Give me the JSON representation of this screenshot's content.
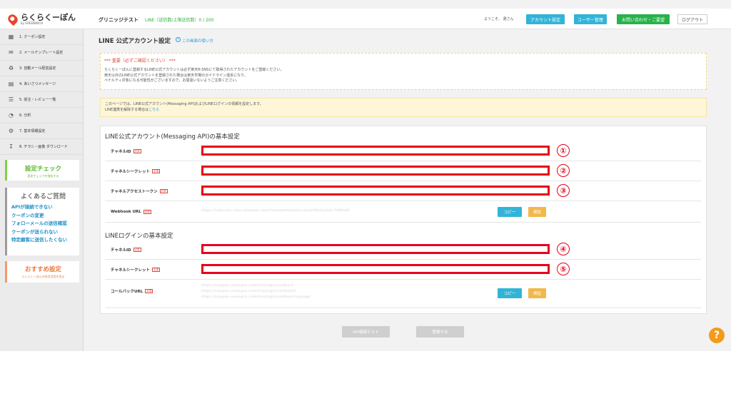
{
  "header": {
    "logo_main": "らくらくーぽん",
    "logo_sub": "by GREENWICH",
    "shop_name": "グリニッジテスト",
    "line_count": "LINE（送信数/上限送信数）0 / 200",
    "welcome": "ようこそ、 書さん",
    "account_settings": "アカウント設定",
    "user_management": "ユーザー管理",
    "contact": "お問い合わせ・ご要望",
    "logout": "ログアウト"
  },
  "sidebar": {
    "items": [
      {
        "label": "1. クーポン設定",
        "icon": "coupon-icon"
      },
      {
        "label": "2. メールテンプレート設定",
        "icon": "mail-icon"
      },
      {
        "label": "3. 自動メール配信設定",
        "icon": "auto-mail-icon"
      },
      {
        "label": "4. あいさつメッセージ",
        "icon": "message-icon"
      },
      {
        "label": "5. 受注・レビュー一覧",
        "icon": "list-icon"
      },
      {
        "label": "6. 分析",
        "icon": "pie-chart-icon"
      },
      {
        "label": "7. 基本情報設定",
        "icon": "gear-icon"
      },
      {
        "label": "8. チラシ・画像 ダウンロード",
        "icon": "download-icon"
      }
    ],
    "settings_check": {
      "title": "設定チェック",
      "subtitle": "設定チェックを強化する"
    },
    "faq": {
      "title": "よくあるご質問",
      "links": [
        "APIが接続できない",
        "クーポンの変更",
        "フォローメールの送信確認",
        "クーポンが送られない",
        "特定顧客に送信したくない"
      ]
    },
    "recommended": {
      "title": "おすすめ設定",
      "subtitle": "らくらくーぽんの有効活用を見る"
    }
  },
  "main": {
    "title": "LINE 公式アカウント設定",
    "help_link": "この画面の使い方",
    "alert": {
      "title": "*** 重要（必ずご確認ください） ***",
      "lines": [
        "らくらくーぽんに登録するLINE公式アカウントは必ず楽天R-SNSにて取得されたアカウントをご登録ください。",
        "楽天以外のLINE公式アカウントを登録された場合は楽天市場のガイドライン違反になり、",
        "ペナルティ対象になる可能性がございますので、お間違いないようご注意ください。"
      ]
    },
    "info": {
      "line1": "このページでは、LINE公式アカウント(Messaging API)およびLINEログインの情報を設定します。",
      "line2_prefix": "LINE連携を解除する場合は",
      "line2_link": "こちら"
    },
    "messaging_api": {
      "title": "LINE公式アカウント(Messaging API)の基本設定",
      "channel_id_label": "チャネルID",
      "channel_secret_label": "チャネルシークレット",
      "access_token_label": "チャネルアクセストークン",
      "webhook_label": "Webhook URL",
      "webhook_value": "https://rakuraku-line.example.com/line/webhook/account/9fe3a1b2c7d84e6f"
    },
    "line_login": {
      "title": "LINEログインの基本設定",
      "channel_id_label": "チャネルID",
      "channel_secret_label": "チャネルシークレット",
      "callback_label": "コールバックURL",
      "callback_lines": [
        "https://coupon.example.com/line/login/callback",
        "https://coupon.example.com/line/login/callback2",
        "https://coupon.example.com/line/login/callback/mypage"
      ]
    },
    "required_badge": "必須",
    "copy_label": "コピー",
    "check_label": "検証",
    "markers": [
      "①",
      "②",
      "③",
      "④",
      "⑤"
    ],
    "api_test_button": "API接続テスト",
    "register_button": "登録する"
  },
  "help_float": "?"
}
